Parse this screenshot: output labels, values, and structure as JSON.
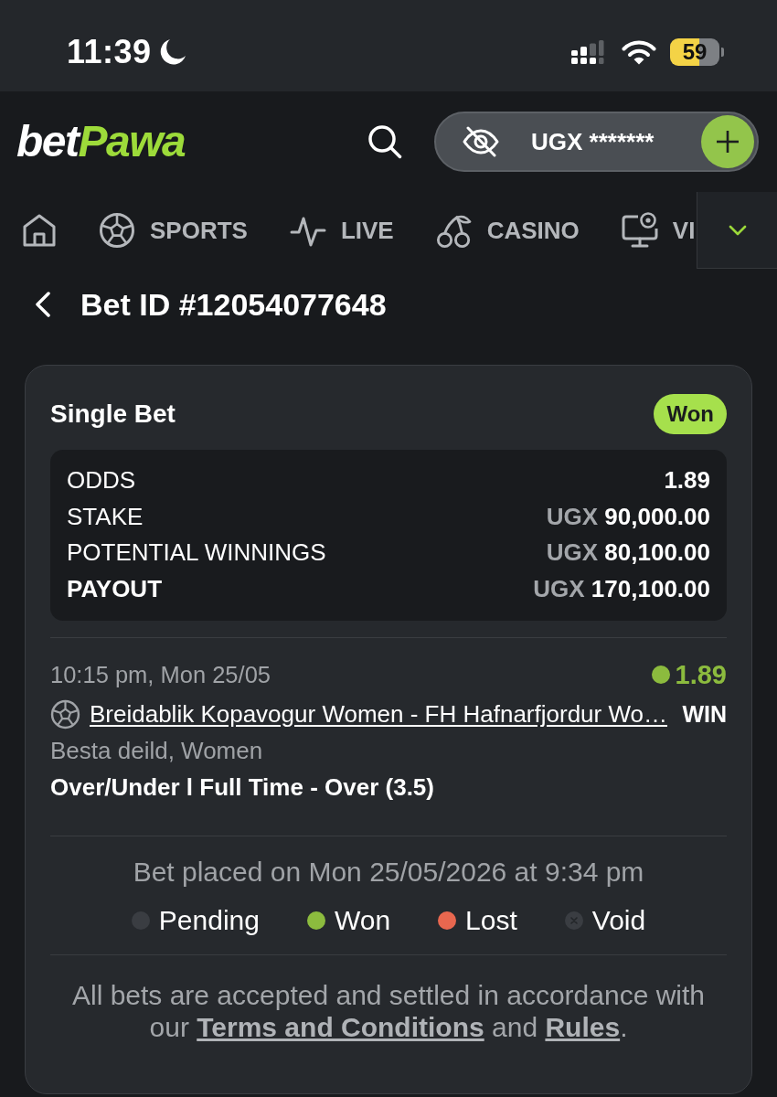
{
  "status_bar": {
    "time": "11:39",
    "battery": "59"
  },
  "header": {
    "logo": [
      {
        "text": "bet",
        "accent": false
      },
      {
        "text": "Pawa",
        "accent": true
      }
    ],
    "balance": "UGX *******"
  },
  "nav": {
    "items": [
      {
        "label": "SPORTS"
      },
      {
        "label": "LIVE"
      },
      {
        "label": "CASINO"
      },
      {
        "label": "VI"
      }
    ]
  },
  "page": {
    "title": "Bet ID #12054077648"
  },
  "bet": {
    "title": "Single Bet",
    "status": "Won",
    "summary": [
      {
        "label": "ODDS",
        "amount": "1.89",
        "bold": false
      },
      {
        "label": "STAKE",
        "currency": "UGX",
        "amount": "90,000.00",
        "bold": false
      },
      {
        "label": "POTENTIAL WINNINGS",
        "currency": "UGX",
        "amount": "80,100.00",
        "bold": false
      },
      {
        "label": "PAYOUT",
        "currency": "UGX",
        "amount": "170,100.00",
        "bold": true
      }
    ],
    "selection": {
      "time": "10:15 pm, Mon 25/05",
      "color": "#8cbb3e",
      "odds": "1.89",
      "match": "Breidablik Kopavogur Women - FH Hafnarfjordur Wo…",
      "result": "WIN",
      "league": "Besta deild, Women",
      "market": "Over/Under l Full Time - Over (3.5)"
    },
    "placed": "Bet placed on Mon 25/05/2026 at 9:34 pm",
    "legend": [
      {
        "label": "Pending",
        "color": "#3a3d42",
        "kind": "dot"
      },
      {
        "label": "Won",
        "color": "#8cbb3e",
        "kind": "dot"
      },
      {
        "label": "Lost",
        "color": "#e8674f",
        "kind": "dot"
      },
      {
        "label": "Void",
        "color": "#3a3d42",
        "kind": "void"
      }
    ],
    "disclaimer": [
      {
        "kind": "text",
        "text": "All bets are accepted and settled in accordance with our "
      },
      {
        "kind": "link",
        "text": "Terms and Conditions"
      },
      {
        "kind": "text",
        "text": " and "
      },
      {
        "kind": "link",
        "text": "Rules"
      },
      {
        "kind": "text",
        "text": "."
      }
    ]
  }
}
